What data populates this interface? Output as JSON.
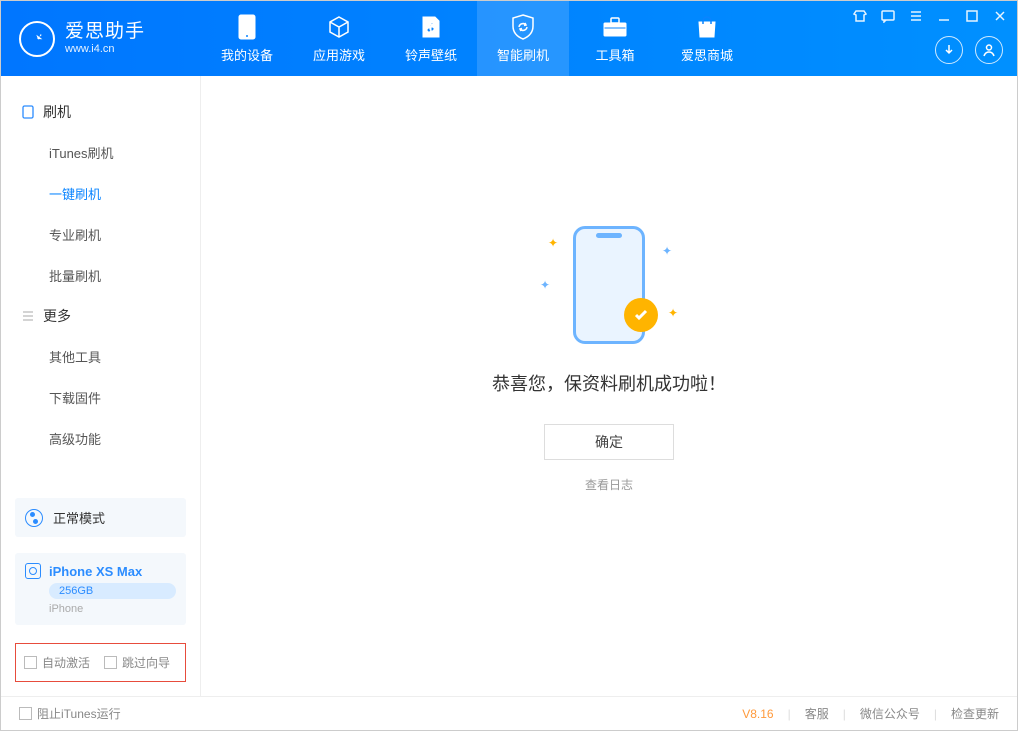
{
  "app": {
    "name_cn": "爱思助手",
    "name_en": "www.i4.cn"
  },
  "nav": {
    "tabs": [
      {
        "label": "我的设备"
      },
      {
        "label": "应用游戏"
      },
      {
        "label": "铃声壁纸"
      },
      {
        "label": "智能刷机"
      },
      {
        "label": "工具箱"
      },
      {
        "label": "爱思商城"
      }
    ],
    "active_index": 3
  },
  "sidebar": {
    "sections": [
      {
        "title": "刷机",
        "items": [
          {
            "label": "iTunes刷机"
          },
          {
            "label": "一键刷机"
          },
          {
            "label": "专业刷机"
          },
          {
            "label": "批量刷机"
          }
        ],
        "active_index": 1
      },
      {
        "title": "更多",
        "items": [
          {
            "label": "其他工具"
          },
          {
            "label": "下载固件"
          },
          {
            "label": "高级功能"
          }
        ],
        "active_index": -1
      }
    ],
    "mode": {
      "label": "正常模式"
    },
    "device": {
      "name": "iPhone XS Max",
      "capacity": "256GB",
      "type": "iPhone"
    },
    "options": {
      "auto_activate": "自动激活",
      "skip_guide": "跳过向导"
    }
  },
  "main": {
    "success_msg": "恭喜您，保资料刷机成功啦！",
    "ok_label": "确定",
    "log_link": "查看日志"
  },
  "footer": {
    "block_itunes": "阻止iTunes运行",
    "version": "V8.16",
    "links": [
      "客服",
      "微信公众号",
      "检查更新"
    ]
  }
}
